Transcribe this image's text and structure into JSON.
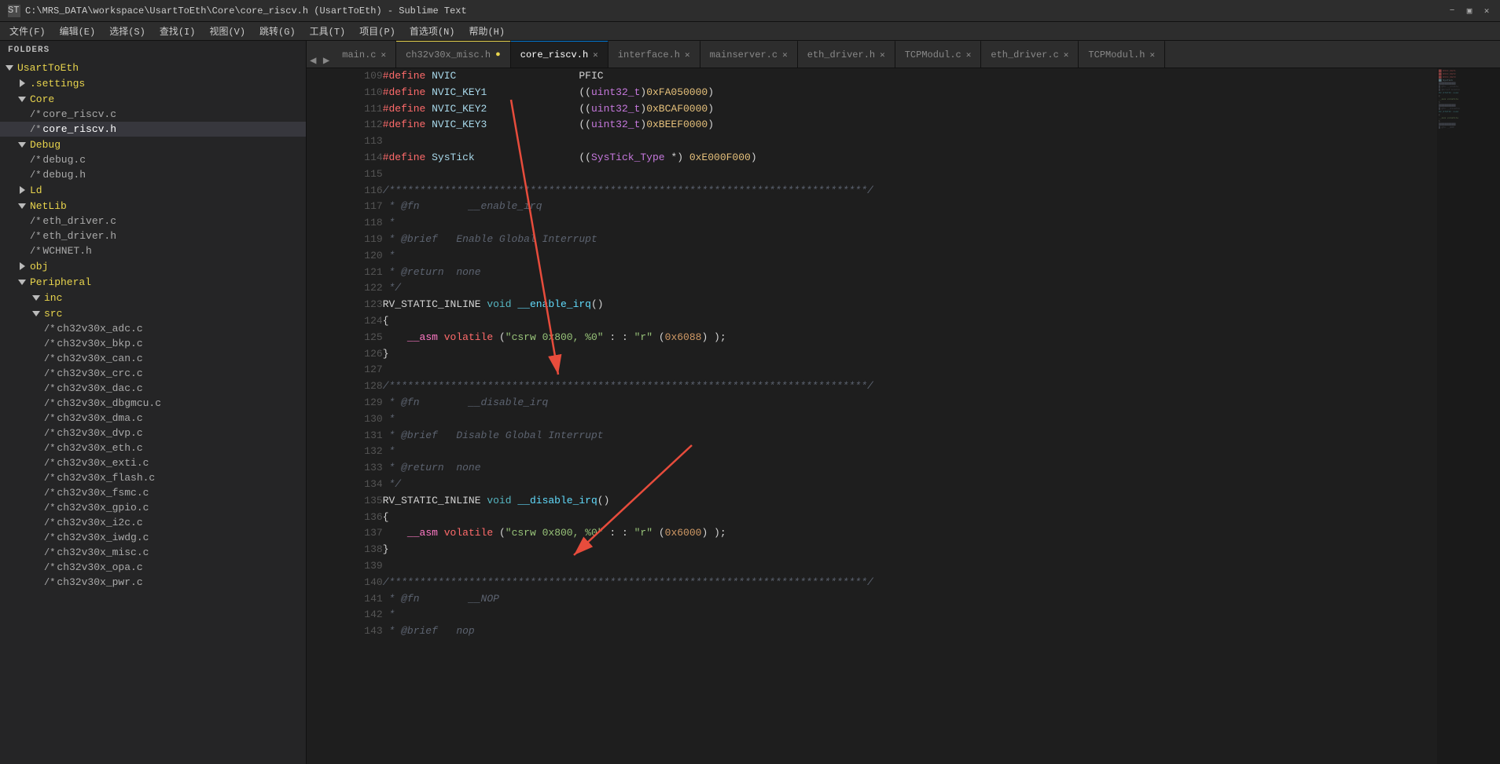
{
  "titlebar": {
    "title": "C:\\MRS_DATA\\workspace\\UsartToEth\\Core\\core_riscv.h (UsartToEth) - Sublime Text",
    "icon": "ST"
  },
  "menubar": {
    "items": [
      "文件(F)",
      "编辑(E)",
      "选择(S)",
      "查找(I)",
      "视图(V)",
      "跳转(G)",
      "工具(T)",
      "项目(P)",
      "首选项(N)",
      "帮助(H)"
    ]
  },
  "sidebar": {
    "header": "FOLDERS",
    "root": "UsartToEth",
    "items": [
      {
        "level": 0,
        "type": "folder",
        "open": false,
        "name": ".settings",
        "indent": 1
      },
      {
        "level": 0,
        "type": "folder",
        "open": true,
        "name": "Core",
        "indent": 1
      },
      {
        "level": 1,
        "type": "file",
        "name": "core_riscv.c",
        "indent": 2
      },
      {
        "level": 1,
        "type": "file",
        "name": "core_riscv.h",
        "indent": 2,
        "active": true
      },
      {
        "level": 0,
        "type": "folder",
        "open": true,
        "name": "Debug",
        "indent": 1
      },
      {
        "level": 1,
        "type": "file",
        "name": "debug.c",
        "indent": 2
      },
      {
        "level": 1,
        "type": "file",
        "name": "debug.h",
        "indent": 2
      },
      {
        "level": 0,
        "type": "folder",
        "open": false,
        "name": "Ld",
        "indent": 1
      },
      {
        "level": 0,
        "type": "folder",
        "open": true,
        "name": "NetLib",
        "indent": 1
      },
      {
        "level": 1,
        "type": "file",
        "name": "eth_driver.c",
        "indent": 2
      },
      {
        "level": 1,
        "type": "file",
        "name": "eth_driver.h",
        "indent": 2
      },
      {
        "level": 1,
        "type": "file",
        "name": "WCHNET.h",
        "indent": 2
      },
      {
        "level": 0,
        "type": "folder",
        "open": false,
        "name": "obj",
        "indent": 1
      },
      {
        "level": 0,
        "type": "folder",
        "open": true,
        "name": "Peripheral",
        "indent": 1
      },
      {
        "level": 1,
        "type": "folder",
        "open": true,
        "name": "inc",
        "indent": 2
      },
      {
        "level": 1,
        "type": "folder",
        "open": true,
        "name": "src",
        "indent": 2
      },
      {
        "level": 2,
        "type": "file",
        "name": "ch32v30x_adc.c",
        "indent": 3
      },
      {
        "level": 2,
        "type": "file",
        "name": "ch32v30x_bkp.c",
        "indent": 3
      },
      {
        "level": 2,
        "type": "file",
        "name": "ch32v30x_can.c",
        "indent": 3
      },
      {
        "level": 2,
        "type": "file",
        "name": "ch32v30x_crc.c",
        "indent": 3
      },
      {
        "level": 2,
        "type": "file",
        "name": "ch32v30x_dac.c",
        "indent": 3
      },
      {
        "level": 2,
        "type": "file",
        "name": "ch32v30x_dbgmcu.c",
        "indent": 3
      },
      {
        "level": 2,
        "type": "file",
        "name": "ch32v30x_dma.c",
        "indent": 3
      },
      {
        "level": 2,
        "type": "file",
        "name": "ch32v30x_dvp.c",
        "indent": 3
      },
      {
        "level": 2,
        "type": "file",
        "name": "ch32v30x_eth.c",
        "indent": 3
      },
      {
        "level": 2,
        "type": "file",
        "name": "ch32v30x_exti.c",
        "indent": 3
      },
      {
        "level": 2,
        "type": "file",
        "name": "ch32v30x_flash.c",
        "indent": 3
      },
      {
        "level": 2,
        "type": "file",
        "name": "ch32v30x_fsmc.c",
        "indent": 3
      },
      {
        "level": 2,
        "type": "file",
        "name": "ch32v30x_gpio.c",
        "indent": 3
      },
      {
        "level": 2,
        "type": "file",
        "name": "ch32v30x_i2c.c",
        "indent": 3
      },
      {
        "level": 2,
        "type": "file",
        "name": "ch32v30x_iwdg.c",
        "indent": 3
      },
      {
        "level": 2,
        "type": "file",
        "name": "ch32v30x_misc.c",
        "indent": 3
      },
      {
        "level": 2,
        "type": "file",
        "name": "ch32v30x_opa.c",
        "indent": 3
      },
      {
        "level": 2,
        "type": "file",
        "name": "ch32v30x_pwr.c",
        "indent": 3
      }
    ]
  },
  "tabs": [
    {
      "label": "main.c",
      "active": false,
      "modified": false
    },
    {
      "label": "ch32v30x_misc.h",
      "active": false,
      "modified": true
    },
    {
      "label": "core_riscv.h",
      "active": true,
      "modified": false
    },
    {
      "label": "interface.h",
      "active": false,
      "modified": false
    },
    {
      "label": "mainserver.c",
      "active": false,
      "modified": false
    },
    {
      "label": "eth_driver.h",
      "active": false,
      "modified": false
    },
    {
      "label": "TCPModul.c",
      "active": false,
      "modified": false
    },
    {
      "label": "eth_driver.c",
      "active": false,
      "modified": false
    },
    {
      "label": "TCPModul.h",
      "active": false,
      "modified": false
    }
  ],
  "code": {
    "lines": [
      {
        "num": 109,
        "content": "#define NVIC                    PFIC"
      },
      {
        "num": 110,
        "content": "#define NVIC_KEY1               ((uint32_t)0xFA050000)"
      },
      {
        "num": 111,
        "content": "#define NVIC_KEY2               ((uint32_t)0xBCAF0000)"
      },
      {
        "num": 112,
        "content": "#define NVIC_KEY3               ((uint32_t)0xBEEF0000)"
      },
      {
        "num": 113,
        "content": ""
      },
      {
        "num": 114,
        "content": "#define SysTick                 ((SysTick_Type *) 0xE000F000)"
      },
      {
        "num": 115,
        "content": ""
      },
      {
        "num": 116,
        "content": "/*******************************************************************************"
      },
      {
        "num": 117,
        "content": " * @fn        __enable_irq"
      },
      {
        "num": 118,
        "content": " *"
      },
      {
        "num": 119,
        "content": " * @brief   Enable Global Interrupt"
      },
      {
        "num": 120,
        "content": " *"
      },
      {
        "num": 121,
        "content": " * @return  none"
      },
      {
        "num": 122,
        "content": " */"
      },
      {
        "num": 123,
        "content": "RV_STATIC_INLINE void __enable_irq()"
      },
      {
        "num": 124,
        "content": "{"
      },
      {
        "num": 125,
        "content": "    __asm volatile (\"csrw 0x800, %0\" : : \"r\" (0x6088) );"
      },
      {
        "num": 126,
        "content": "}"
      },
      {
        "num": 127,
        "content": ""
      },
      {
        "num": 128,
        "content": "/*******************************************************************************"
      },
      {
        "num": 129,
        "content": " * @fn        __disable_irq"
      },
      {
        "num": 130,
        "content": " *"
      },
      {
        "num": 131,
        "content": " * @brief   Disable Global Interrupt"
      },
      {
        "num": 132,
        "content": " *"
      },
      {
        "num": 133,
        "content": " * @return  none"
      },
      {
        "num": 134,
        "content": " */"
      },
      {
        "num": 135,
        "content": "RV_STATIC_INLINE void __disable_irq()"
      },
      {
        "num": 136,
        "content": "{"
      },
      {
        "num": 137,
        "content": "    __asm volatile (\"csrw 0x800, %0\" : : \"r\" (0x6000) );"
      },
      {
        "num": 138,
        "content": "}"
      },
      {
        "num": 139,
        "content": ""
      },
      {
        "num": 140,
        "content": "/*******************************************************************************"
      },
      {
        "num": 141,
        "content": " * @fn        __NOP"
      },
      {
        "num": 142,
        "content": " *"
      },
      {
        "num": 143,
        "content": " * @brief   nop"
      }
    ]
  }
}
